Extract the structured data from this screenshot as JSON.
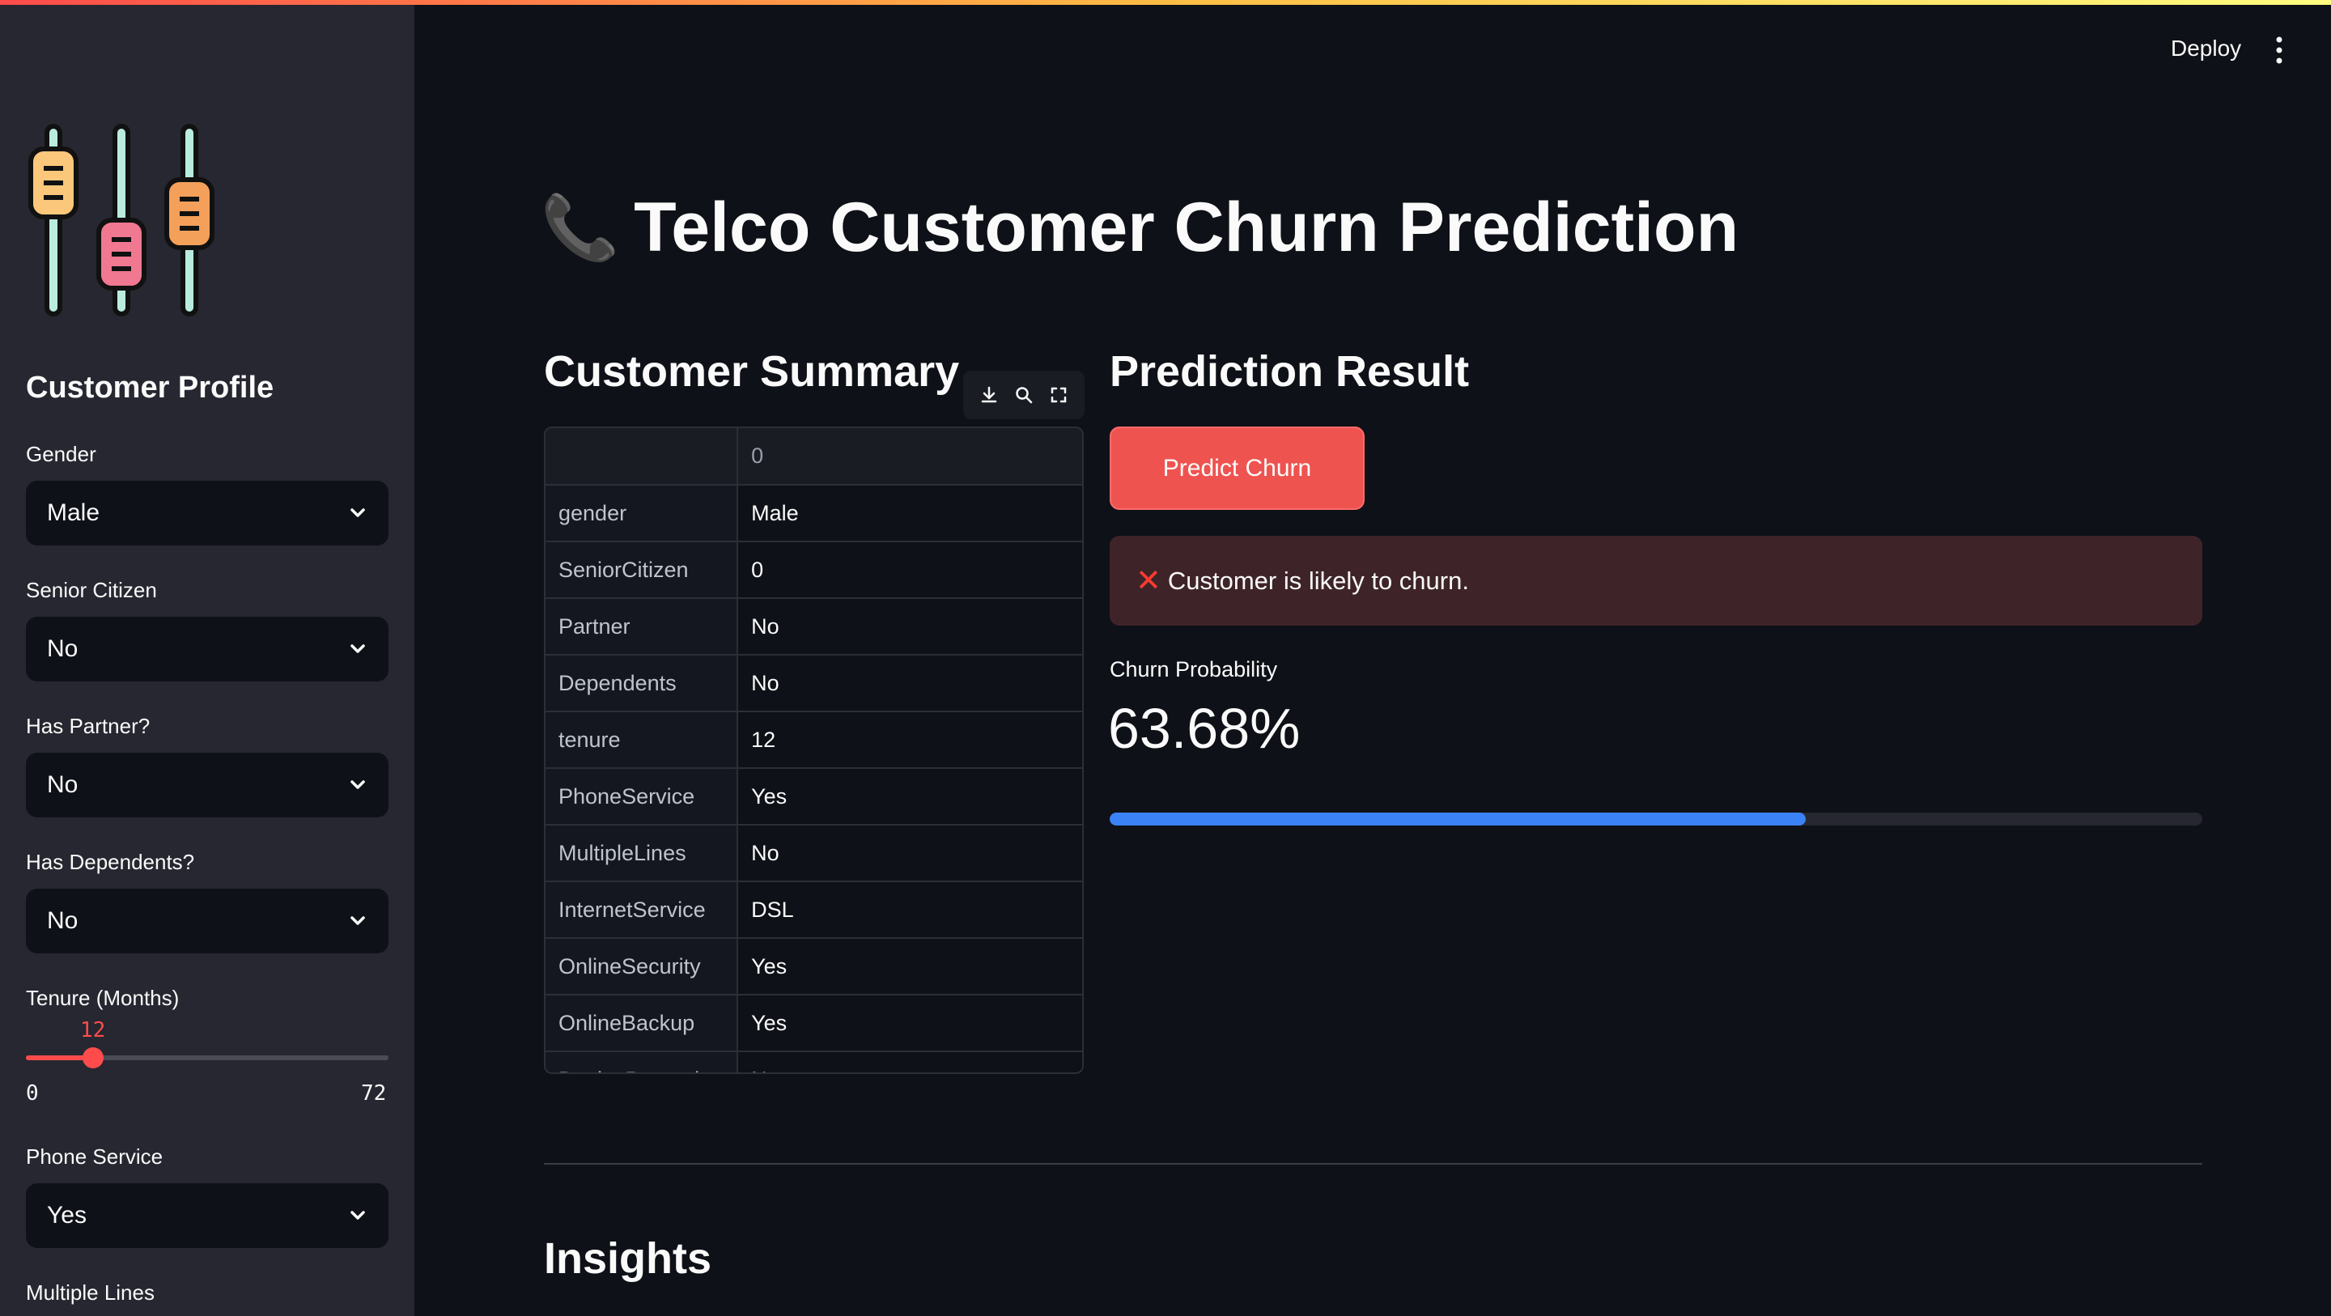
{
  "header": {
    "deploy_label": "Deploy"
  },
  "sidebar": {
    "heading": "Customer Profile",
    "gender": {
      "label": "Gender",
      "value": "Male"
    },
    "senior_citizen": {
      "label": "Senior Citizen",
      "value": "No"
    },
    "partner": {
      "label": "Has Partner?",
      "value": "No"
    },
    "dependents": {
      "label": "Has Dependents?",
      "value": "No"
    },
    "tenure": {
      "label": "Tenure (Months)",
      "value": "12",
      "min": "0",
      "max": "72",
      "fraction": 0.1667
    },
    "phone_service": {
      "label": "Phone Service",
      "value": "Yes"
    },
    "multiple_lines": {
      "label": "Multiple Lines"
    }
  },
  "main": {
    "title_icon": "📞",
    "title": "Telco Customer Churn Prediction",
    "summary": {
      "heading": "Customer Summary",
      "column_header": "0",
      "rows": [
        {
          "field": "gender",
          "value": "Male"
        },
        {
          "field": "SeniorCitizen",
          "value": "0"
        },
        {
          "field": "Partner",
          "value": "No"
        },
        {
          "field": "Dependents",
          "value": "No"
        },
        {
          "field": "tenure",
          "value": "12"
        },
        {
          "field": "PhoneService",
          "value": "Yes"
        },
        {
          "field": "MultipleLines",
          "value": "No"
        },
        {
          "field": "InternetService",
          "value": "DSL"
        },
        {
          "field": "OnlineSecurity",
          "value": "Yes"
        },
        {
          "field": "OnlineBackup",
          "value": "Yes"
        },
        {
          "field": "DeviceProtection",
          "value": "No"
        }
      ]
    },
    "prediction": {
      "heading": "Prediction Result",
      "button_label": "Predict Churn",
      "alert_text": "Customer is likely to churn.",
      "metric_label": "Churn Probability",
      "metric_value": "63.68%",
      "progress_fraction": 0.6368
    },
    "insights_heading": "Insights"
  },
  "colors": {
    "accent": "#ff4b4b",
    "progress": "#3b82f6",
    "alert_bg": "#3e2428"
  }
}
